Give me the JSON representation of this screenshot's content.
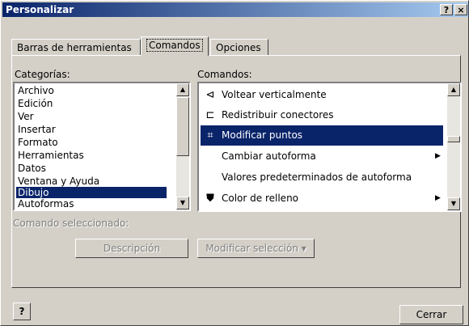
{
  "window": {
    "title": "Personalizar",
    "help_btn": "?",
    "close_btn": "×"
  },
  "tabs": [
    {
      "label": "Barras de herramientas",
      "active": false
    },
    {
      "label": "Comandos",
      "active": true
    },
    {
      "label": "Opciones",
      "active": false
    }
  ],
  "categories": {
    "label": "Categorías:",
    "items": [
      "Archivo",
      "Edición",
      "Ver",
      "Insertar",
      "Formato",
      "Herramientas",
      "Datos",
      "Ventana y Ayuda",
      "Dibujo",
      "Autoformas"
    ],
    "selected": "Dibujo"
  },
  "commands": {
    "label": "Comandos:",
    "items": [
      {
        "label": "Voltear verticalmente",
        "icon": "flip-vertical-icon",
        "submenu": false
      },
      {
        "label": "Redistribuir conectores",
        "icon": "reroute-connectors-icon",
        "submenu": false
      },
      {
        "label": "Modificar puntos",
        "icon": "edit-points-icon",
        "submenu": false,
        "selected": true
      },
      {
        "label": "Cambiar autoforma",
        "icon": "",
        "submenu": true
      },
      {
        "label": "Valores predeterminados de autoforma",
        "icon": "",
        "submenu": false
      },
      {
        "label": "Color de relleno",
        "icon": "fill-color-icon",
        "submenu": true
      }
    ]
  },
  "selected_command": {
    "label": "Comando seleccionado:",
    "description_button": "Descripción",
    "modify_selection_button": "Modificar selección ▾"
  },
  "footer": {
    "help_icon": "?",
    "close_button": "Cerrar"
  },
  "colors": {
    "selection": "#0a246a",
    "face": "#d4d0c8"
  }
}
